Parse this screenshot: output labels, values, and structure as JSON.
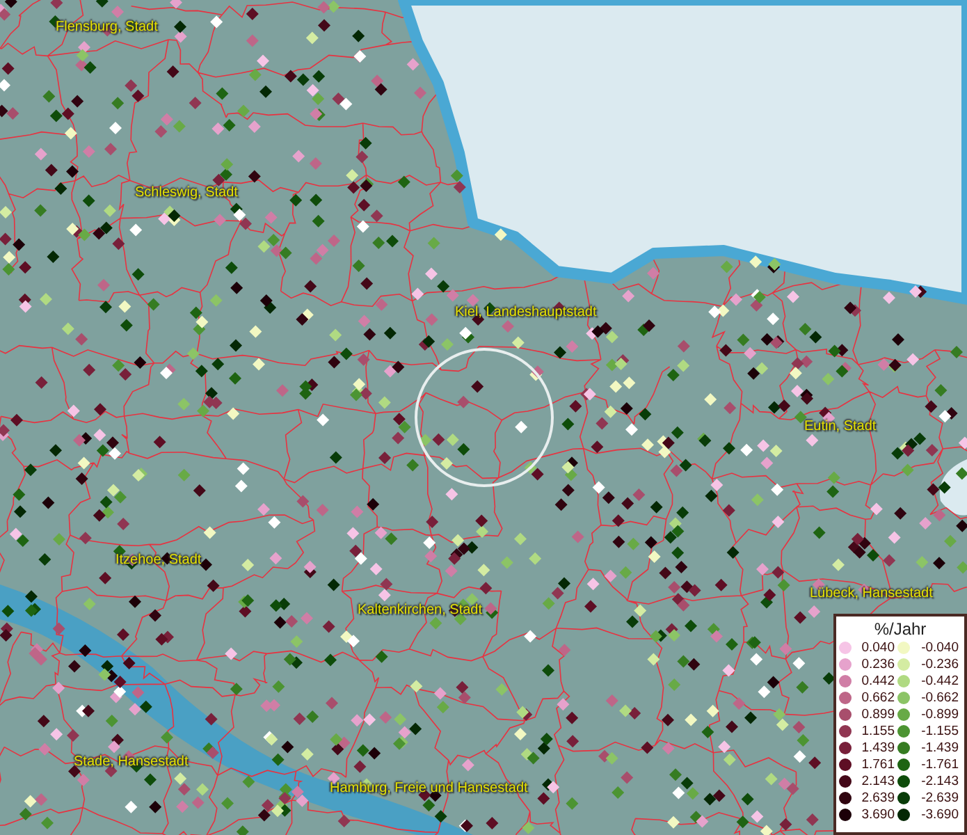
{
  "map": {
    "place_labels": [
      "Flensburg, Stadt",
      "Schleswig, Stadt",
      "Kiel, Landeshauptstadt",
      "Eutin, Stadt",
      "Itzehoe, Stadt",
      "Kaltenkirchen, Stadt",
      "Lübeck, Hansestadt",
      "Stade, Hansestadt",
      "Hamburg, Freie und Hansestadt"
    ]
  },
  "legend": {
    "title": "%/Jahr",
    "positive": [
      {
        "label": "0.040",
        "color": "#f6c4e6"
      },
      {
        "label": "0.236",
        "color": "#e6a2cc"
      },
      {
        "label": "0.442",
        "color": "#d07ea6"
      },
      {
        "label": "0.662",
        "color": "#be6688"
      },
      {
        "label": "0.899",
        "color": "#a84e6c"
      },
      {
        "label": "1.155",
        "color": "#903652"
      },
      {
        "label": "1.439",
        "color": "#78203a"
      },
      {
        "label": "1.761",
        "color": "#5e0e24"
      },
      {
        "label": "2.143",
        "color": "#440818"
      },
      {
        "label": "2.639",
        "color": "#300410"
      },
      {
        "label": "3.690",
        "color": "#1c0008"
      }
    ],
    "negative": [
      {
        "label": "-0.040",
        "color": "#f2f8c2"
      },
      {
        "label": "-0.236",
        "color": "#d4eca2"
      },
      {
        "label": "-0.442",
        "color": "#b0da82"
      },
      {
        "label": "-0.662",
        "color": "#8cc466"
      },
      {
        "label": "-0.899",
        "color": "#68aa46"
      },
      {
        "label": "-1.155",
        "color": "#4c9432"
      },
      {
        "label": "-1.439",
        "color": "#367c22"
      },
      {
        "label": "-1.761",
        "color": "#1e6412"
      },
      {
        "label": "-2.143",
        "color": "#0e4c0a"
      },
      {
        "label": "-2.639",
        "color": "#083c08"
      },
      {
        "label": "-3.690",
        "color": "#042804"
      }
    ]
  }
}
